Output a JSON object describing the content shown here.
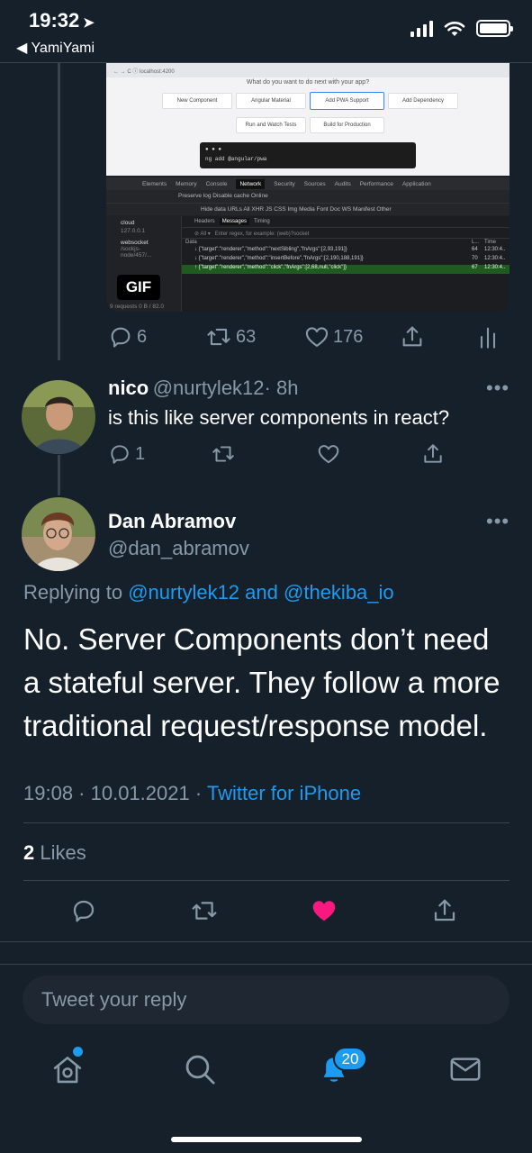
{
  "status_bar": {
    "time": "19:32",
    "back_app": "YamiYami"
  },
  "media": {
    "url": "localhost:4200",
    "question": "What do you want to do next with your app?",
    "chips": [
      "New Component",
      "Angular Material",
      "Add PWA Support",
      "Add Dependency",
      "Run and Watch Tests",
      "Build for Production"
    ],
    "terminal_command": "ng add @angular/pwa",
    "devtools_tabs": [
      "Elements",
      "Memory",
      "Console",
      "Network",
      "Security",
      "Sources",
      "Audits",
      "Performance",
      "Application"
    ],
    "toolbar_text": "Preserve log   Disable cache   Online",
    "filter_text": "Hide data URLs  All  XHR  JS  CSS  Img  Media  Font  Doc  WS  Manifest  Other",
    "left_items": [
      {
        "name": "cloud",
        "sub": "127.0.0.1"
      },
      {
        "name": "websocket",
        "sub": "/sockjs-node/457/..."
      }
    ],
    "left_footer": "9 requests   0 B / 82.0",
    "subtabs": [
      "Headers",
      "Messages",
      "Timing"
    ],
    "filter_placeholder": "Enter regex, for example: (web)?socket",
    "columns": [
      "Data",
      "L...",
      "Time"
    ],
    "messages": [
      {
        "text": "{\"target\":\"renderer\",\"method\":\"nextSibling\",\"fnArgs\":[2,93,191]}",
        "len": "64",
        "time": "12:30:4.."
      },
      {
        "text": "{\"target\":\"renderer\",\"method\":\"insertBefore\",\"fnArgs\":[2,190,188,191]}",
        "len": "70",
        "time": "12:30:4.."
      },
      {
        "text": "{\"target\":\"renderer\",\"method\":\"click\",\"fnArgs\":[2,68,null,\"click\"]}",
        "len": "67",
        "time": "12:30:4.."
      }
    ],
    "gif_label": "GIF"
  },
  "tweet1_actions": {
    "replies": "6",
    "retweets": "63",
    "likes": "176"
  },
  "reply_tweet": {
    "name": "nico",
    "handle": "@nurtylek12",
    "time": "· 8h",
    "text": "is this like server components in react?",
    "replies": "1"
  },
  "main_tweet": {
    "name": "Dan Abramov",
    "handle": "@dan_abramov",
    "replying_prefix": "Replying to",
    "replying_user1": "@nurtylek12",
    "replying_and": "and",
    "replying_user2": "@thekiba_io",
    "text": "No. Server Components don’t need a stateful server. They follow a more traditional request/response model.",
    "timestamp": "19:08 · 10.01.2021 ·",
    "source": "Twitter for iPhone",
    "likes_count": "2",
    "likes_label": "Likes"
  },
  "reply_input": {
    "placeholder": "Tweet your reply"
  },
  "tabbar": {
    "notifications_badge": "20"
  },
  "colors": {
    "background": "#15202b",
    "accent": "#1d9bf0",
    "like": "#f91880",
    "muted": "#8899a6"
  }
}
